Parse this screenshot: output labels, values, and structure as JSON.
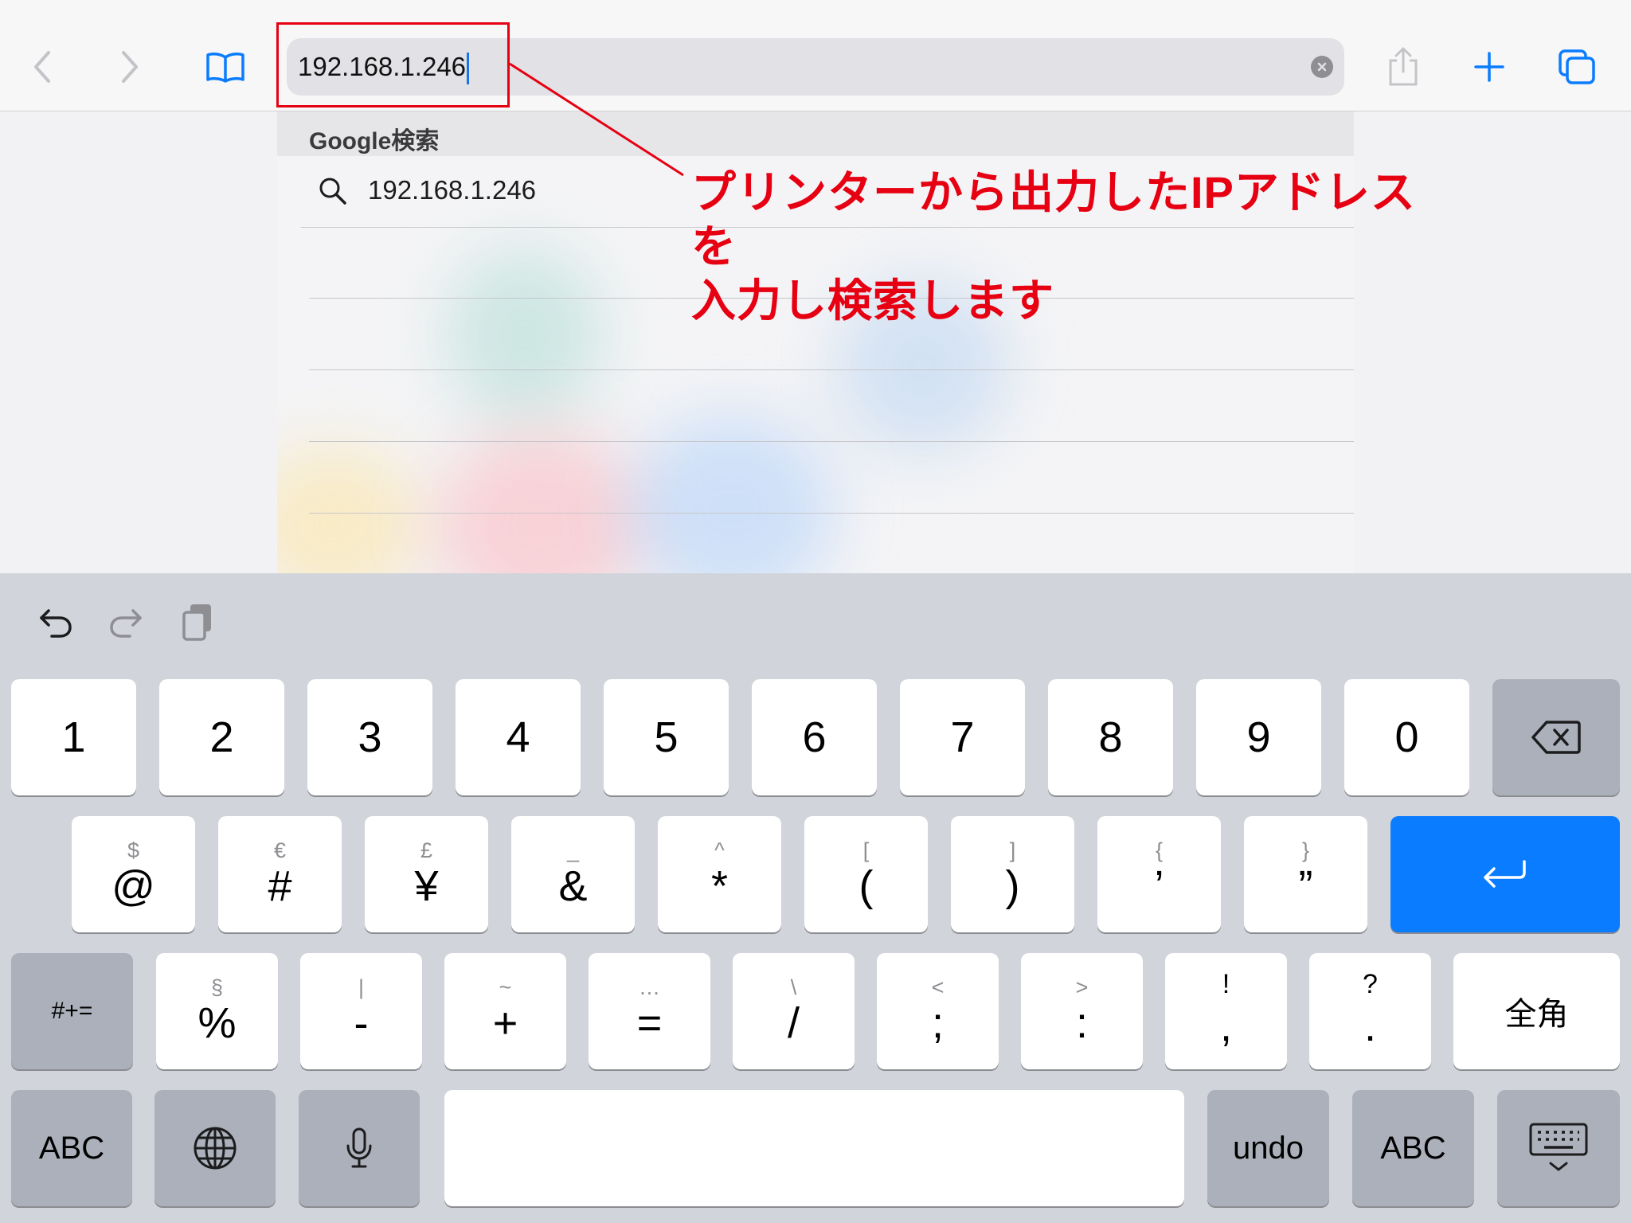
{
  "toolbar": {
    "url_value": "192.168.1.246"
  },
  "suggestions": {
    "header": "Google検索",
    "items": [
      "192.168.1.246"
    ]
  },
  "annotation": {
    "line1": "プリンターから出力したIPアドレスを",
    "line2": "入力し検索します",
    "color": "#e60012"
  },
  "keyboard": {
    "row1": [
      "1",
      "2",
      "3",
      "4",
      "5",
      "6",
      "7",
      "8",
      "9",
      "0"
    ],
    "row2": [
      {
        "sub": "$",
        "main": "@"
      },
      {
        "sub": "€",
        "main": "#"
      },
      {
        "sub": "£",
        "main": "¥"
      },
      {
        "sub": "_",
        "main": "&"
      },
      {
        "sub": "^",
        "main": "*"
      },
      {
        "sub": "[",
        "main": "("
      },
      {
        "sub": "]",
        "main": ")"
      },
      {
        "sub": "{",
        "main": "’"
      },
      {
        "sub": "}",
        "main": "”"
      }
    ],
    "row3_left": "#+=",
    "row3": [
      {
        "sub": "§",
        "main": "%"
      },
      {
        "sub": "|",
        "main": "-"
      },
      {
        "sub": "~",
        "main": "+"
      },
      {
        "sub": "…",
        "main": "="
      },
      {
        "sub": "\\",
        "main": "/"
      },
      {
        "sub": "<",
        "main": ";"
      },
      {
        "sub": ">",
        "main": ":"
      },
      {
        "sub": "!",
        "main": ","
      },
      {
        "sub": "?",
        "main": "."
      }
    ],
    "row3_right": "全角",
    "row4": {
      "abc_left": "ABC",
      "undo": "undo",
      "abc_right": "ABC"
    },
    "accent_color": "#0a7cff"
  }
}
